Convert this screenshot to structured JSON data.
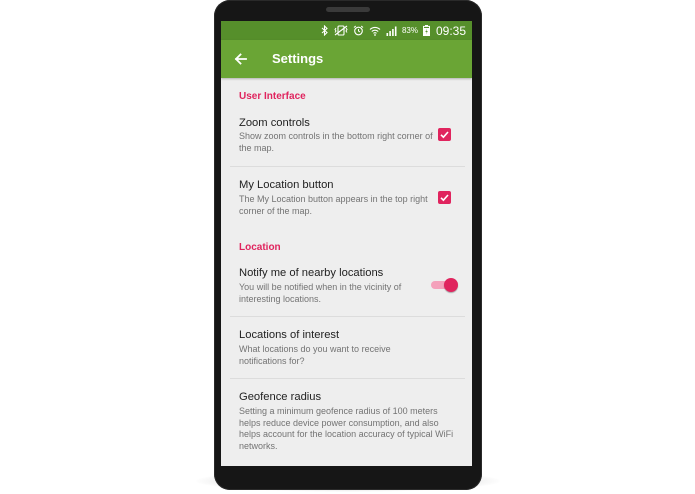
{
  "status_bar": {
    "icons": [
      "bluetooth-icon",
      "vibrate-icon",
      "alarm-icon",
      "wifi-icon",
      "cell-signal-icon",
      "battery-icon"
    ],
    "battery_percent": "83%",
    "time": "09:35"
  },
  "app_bar": {
    "back_icon": "arrow-left-icon",
    "title": "Settings"
  },
  "sections": {
    "user_interface": {
      "header": "User Interface",
      "zoom_controls": {
        "title": "Zoom controls",
        "summary": "Show zoom controls in the bottom right corner of the map.",
        "checked": true
      },
      "my_location_button": {
        "title": "My Location button",
        "summary": "The My Location button appears in the top right corner of the map.",
        "checked": true
      }
    },
    "location": {
      "header": "Location",
      "notify_nearby": {
        "title": "Notify me of nearby locations",
        "summary": "You will be notified when in the vicinity of interesting locations.",
        "enabled": true
      },
      "locations_of_interest": {
        "title": "Locations of interest",
        "summary": "What locations do you want to receive notifications for?"
      },
      "geofence_radius": {
        "title": "Geofence radius",
        "summary": "Setting a minimum geofence radius of 100 meters helps reduce device power consumption, and also helps account for the location accuracy of typical WiFi networks."
      }
    }
  },
  "colors": {
    "status_bar": "#568f2b",
    "app_bar": "#6aa535",
    "accent": "#e0245e",
    "background": "#eeeeee"
  }
}
